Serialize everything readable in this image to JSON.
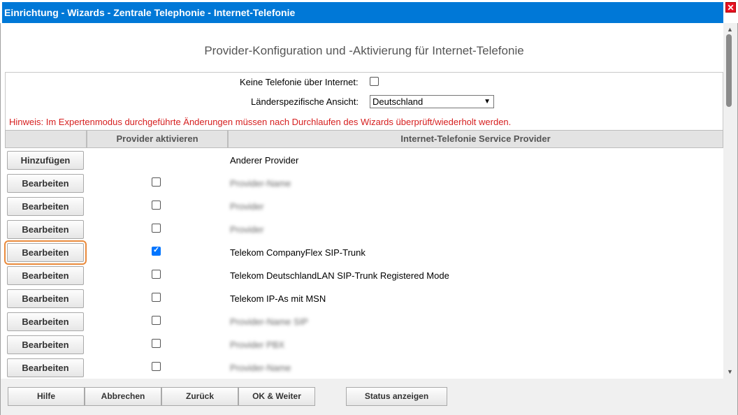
{
  "window": {
    "title": "Einrichtung - Wizards - Zentrale Telephonie - Internet-Telefonie",
    "close_symbol": "✕"
  },
  "page": {
    "heading": "Provider-Konfiguration und -Aktivierung für Internet-Telefonie"
  },
  "form": {
    "no_internet_label": "Keine Telefonie über Internet:",
    "country_label": "Länderspezifische Ansicht:",
    "country_value": "Deutschland",
    "hint": "Hinweis: Im Expertenmodus durchgeführte Änderungen müssen nach Durchlaufen des Wizards überprüft/wiederholt werden."
  },
  "table": {
    "headers": [
      "",
      "Provider aktivieren",
      "Internet-Telefonie Service Provider"
    ],
    "rows": [
      {
        "button": "Hinzufügen",
        "checkbox": null,
        "provider": "Anderer Provider"
      },
      {
        "button": "Bearbeiten",
        "checkbox": false,
        "provider": "Provider-Name"
      },
      {
        "button": "Bearbeiten",
        "checkbox": false,
        "provider": "Provider"
      },
      {
        "button": "Bearbeiten",
        "checkbox": false,
        "provider": "Provider"
      },
      {
        "button": "Bearbeiten",
        "checkbox": true,
        "provider": "Telekom CompanyFlex SIP-Trunk"
      },
      {
        "button": "Bearbeiten",
        "checkbox": false,
        "provider": "Telekom DeutschlandLAN SIP-Trunk Registered Mode"
      },
      {
        "button": "Bearbeiten",
        "checkbox": false,
        "provider": "Telekom IP-As mit MSN"
      },
      {
        "button": "Bearbeiten",
        "checkbox": false,
        "provider": "Provider-Name SIP"
      },
      {
        "button": "Bearbeiten",
        "checkbox": false,
        "provider": "Provider PBX"
      },
      {
        "button": "Bearbeiten",
        "checkbox": false,
        "provider": "Provider-Name"
      }
    ]
  },
  "footer": {
    "help": "Hilfe",
    "cancel": "Abbrechen",
    "back": "Zurück",
    "ok_next": "OK & Weiter",
    "status": "Status anzeigen"
  },
  "colors": {
    "titlebar": "#0078d7",
    "hint": "#d62020",
    "focus_outline": "#e98a3c"
  }
}
